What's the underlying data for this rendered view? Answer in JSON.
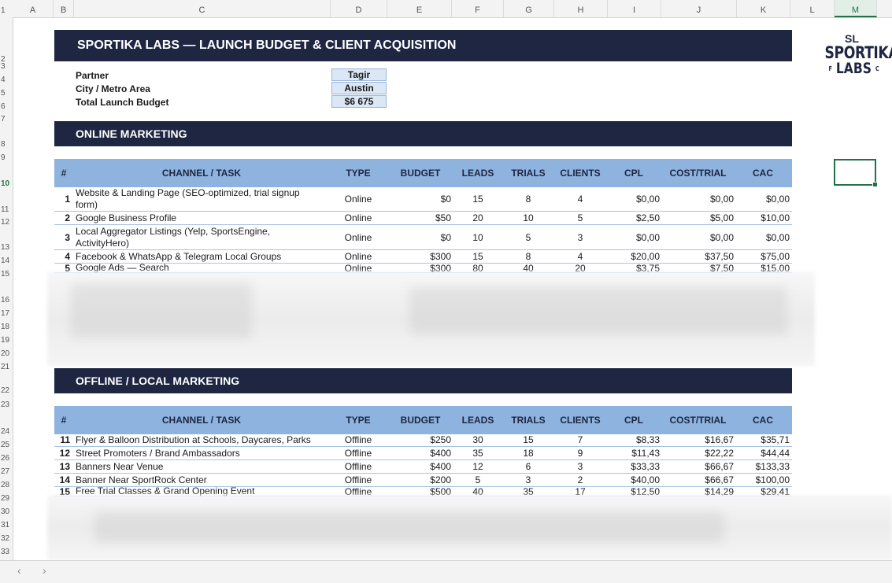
{
  "columns": [
    "A",
    "B",
    "C",
    "D",
    "E",
    "F",
    "G",
    "H",
    "I",
    "J",
    "K",
    "L",
    "M"
  ],
  "rows": [
    "1",
    "2",
    "3",
    "4",
    "5",
    "6",
    "7",
    "8",
    "9",
    "10",
    "11",
    "12",
    "13",
    "14",
    "15",
    "16",
    "17",
    "18",
    "19",
    "20",
    "21",
    "22",
    "23",
    "24",
    "25",
    "26",
    "27",
    "28",
    "29",
    "30",
    "31",
    "32",
    "33"
  ],
  "title": "SPORTIKA LABS — LAUNCH BUDGET & CLIENT ACQUISITION",
  "info": {
    "partner_label": "Partner",
    "partner_value": "Tagir",
    "city_label": "City / Metro Area",
    "city_value": "Austin",
    "budget_label": "Total Launch Budget",
    "budget_value": "$6 675"
  },
  "headers": [
    "#",
    "CHANNEL / TASK",
    "TYPE",
    "BUDGET",
    "LEADS",
    "TRIALS",
    "CLIENTS",
    "CPL",
    "COST/TRIAL",
    "CAC"
  ],
  "online": {
    "section_title": "ONLINE MARKETING",
    "rows": [
      {
        "num": "1",
        "channel": "Website & Landing Page (SEO-optimized, trial signup form)",
        "type": "Online",
        "budget": "$0",
        "leads": "15",
        "trials": "8",
        "clients": "4",
        "cpl": "$0,00",
        "cost_trial": "$0,00",
        "cac": "$0,00"
      },
      {
        "num": "2",
        "channel": "Google Business Profile",
        "type": "Online",
        "budget": "$50",
        "leads": "20",
        "trials": "10",
        "clients": "5",
        "cpl": "$2,50",
        "cost_trial": "$5,00",
        "cac": "$10,00"
      },
      {
        "num": "3",
        "channel": "Local Aggregator Listings (Yelp, SportsEngine, ActivityHero)",
        "type": "Online",
        "budget": "$0",
        "leads": "10",
        "trials": "5",
        "clients": "3",
        "cpl": "$0,00",
        "cost_trial": "$0,00",
        "cac": "$0,00"
      },
      {
        "num": "4",
        "channel": "Facebook & WhatsApp & Telegram Local Groups",
        "type": "Online",
        "budget": "$300",
        "leads": "15",
        "trials": "8",
        "clients": "4",
        "cpl": "$20,00",
        "cost_trial": "$37,50",
        "cac": "$75,00"
      },
      {
        "num": "5",
        "channel": "Google Ads — Search",
        "type": "Online",
        "budget": "$300",
        "leads": "80",
        "trials": "40",
        "clients": "20",
        "cpl": "$3,75",
        "cost_trial": "$7,50",
        "cac": "$15,00"
      }
    ]
  },
  "offline": {
    "section_title": "OFFLINE / LOCAL MARKETING",
    "rows": [
      {
        "num": "11",
        "channel": "Flyer & Balloon Distribution at Schools, Daycares, Parks",
        "type": "Offline",
        "budget": "$250",
        "leads": "30",
        "trials": "15",
        "clients": "7",
        "cpl": "$8,33",
        "cost_trial": "$16,67",
        "cac": "$35,71"
      },
      {
        "num": "12",
        "channel": "Street Promoters / Brand Ambassadors",
        "type": "Offline",
        "budget": "$400",
        "leads": "35",
        "trials": "18",
        "clients": "9",
        "cpl": "$11,43",
        "cost_trial": "$22,22",
        "cac": "$44,44"
      },
      {
        "num": "13",
        "channel": "Banners Near Venue",
        "type": "Offline",
        "budget": "$400",
        "leads": "12",
        "trials": "6",
        "clients": "3",
        "cpl": "$33,33",
        "cost_trial": "$66,67",
        "cac": "$133,33"
      },
      {
        "num": "14",
        "channel": "Banner Near SportRock Center",
        "type": "Offline",
        "budget": "$200",
        "leads": "5",
        "trials": "3",
        "clients": "2",
        "cpl": "$40,00",
        "cost_trial": "$66,67",
        "cac": "$100,00"
      },
      {
        "num": "15",
        "channel": "Free Trial Classes & Grand Opening Event",
        "type": "Offline",
        "budget": "$500",
        "leads": "40",
        "trials": "35",
        "clients": "17",
        "cpl": "$12,50",
        "cost_trial": "$14,29",
        "cac": "$29,41"
      }
    ]
  },
  "logo": {
    "mark": "SL",
    "top": "SPORTIKA",
    "bottom": "LABS",
    "left": "F",
    "right": "C"
  },
  "nav": {
    "prev": "‹",
    "next": "›"
  },
  "colors": {
    "navy": "#1e2642",
    "header_blue": "#8db3de",
    "input_blue": "#dbe7f5",
    "selection_green": "#217346"
  }
}
